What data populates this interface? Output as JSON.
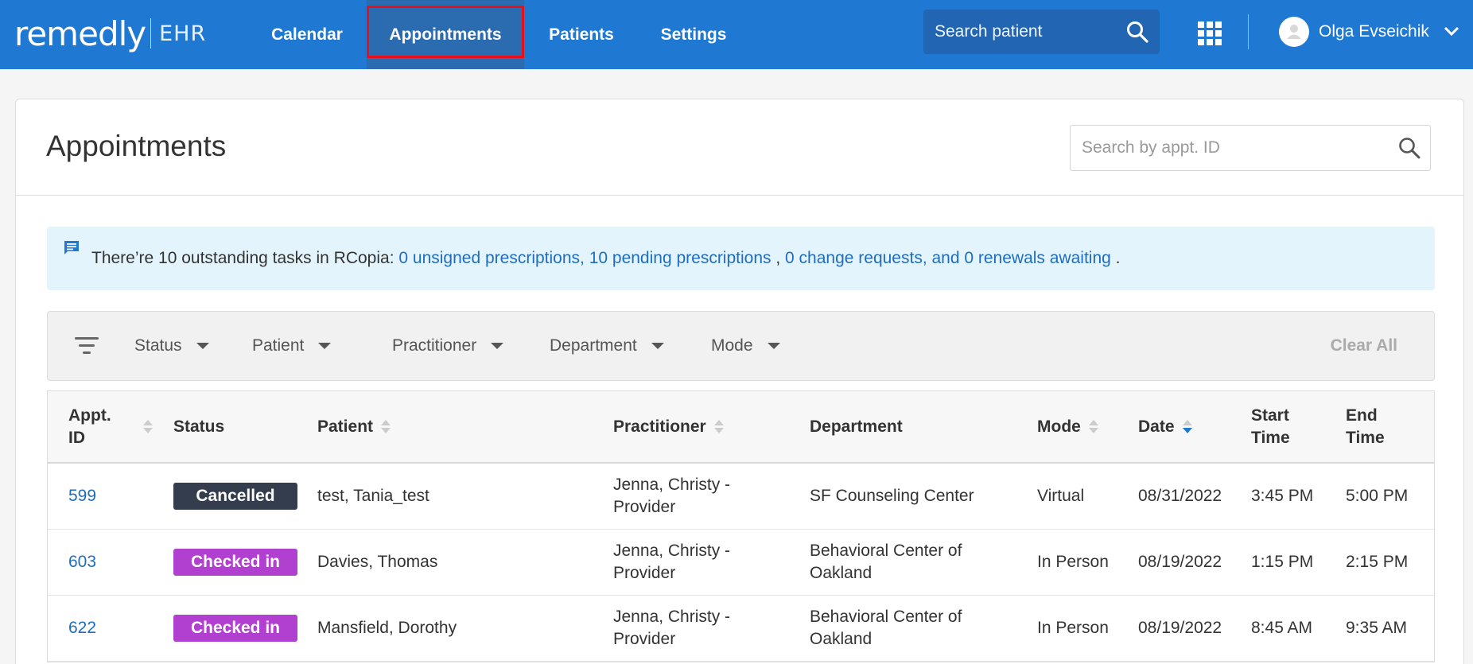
{
  "app": {
    "logo_main": "remedly",
    "logo_sub": "EHR"
  },
  "nav": {
    "items": [
      {
        "label": "Calendar"
      },
      {
        "label": "Appointments",
        "active": true
      },
      {
        "label": "Patients"
      },
      {
        "label": "Settings"
      }
    ],
    "search_placeholder": "Search patient",
    "user_name": "Olga Evseichik"
  },
  "page": {
    "title": "Appointments",
    "search_placeholder": "Search by appt. ID"
  },
  "alert": {
    "prefix": "There’re 10 outstanding tasks in RCopia: ",
    "link1": "0 unsigned prescriptions, 10 pending prescriptions",
    "sep1": " , ",
    "link2": "0 change requests, and 0 renewals awaiting",
    "suffix": " ."
  },
  "filters": {
    "items": [
      "Status",
      "Patient",
      "Practitioner",
      "Department",
      "Mode"
    ],
    "clear_all": "Clear All"
  },
  "table": {
    "headers": {
      "appt_id_1": "Appt.",
      "appt_id_2": "ID",
      "status": "Status",
      "patient": "Patient",
      "practitioner": "Practitioner",
      "department": "Department",
      "mode": "Mode",
      "date": "Date",
      "start_1": "Start",
      "start_2": "Time",
      "end_1": "End",
      "end_2": "Time"
    },
    "rows": [
      {
        "id": "599",
        "status": "Cancelled",
        "patient": "test, Tania_test",
        "practitioner_1": "Jenna, Christy -",
        "practitioner_2": "Provider",
        "department_1": "SF Counseling Center",
        "department_2": "",
        "mode": "Virtual",
        "date": "08/31/2022",
        "start": "3:45 PM",
        "end": "5:00 PM"
      },
      {
        "id": "603",
        "status": "Checked in",
        "patient": "Davies, Thomas",
        "practitioner_1": "Jenna, Christy -",
        "practitioner_2": "Provider",
        "department_1": "Behavioral Center of",
        "department_2": "Oakland",
        "mode": "In Person",
        "date": "08/19/2022",
        "start": "1:15 PM",
        "end": "2:15 PM"
      },
      {
        "id": "622",
        "status": "Checked in",
        "patient": "Mansfield, Dorothy",
        "practitioner_1": "Jenna, Christy -",
        "practitioner_2": "Provider",
        "department_1": "Behavioral Center of",
        "department_2": "Oakland",
        "mode": "In Person",
        "date": "08/19/2022",
        "start": "8:45 AM",
        "end": "9:35 AM"
      }
    ]
  },
  "colors": {
    "nav_bg": "#1f78d1",
    "cancelled_badge": "#343d4d",
    "checked_in_badge": "#b13fcf",
    "link": "#1f6dbf"
  }
}
